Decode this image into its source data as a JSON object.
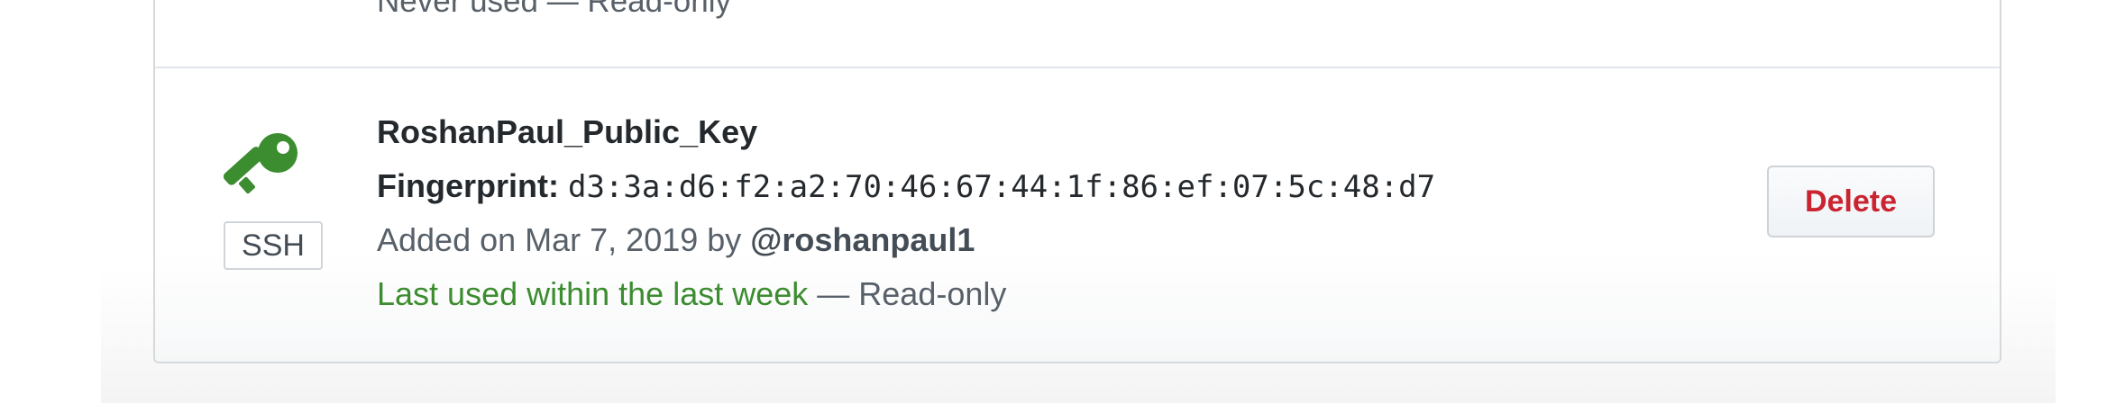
{
  "previous_key": {
    "status": "Never used — Read-only"
  },
  "key": {
    "title": "RoshanPaul_Public_Key",
    "fingerprint_label": "Fingerprint:",
    "fingerprint_value": "d3:3a:d6:f2:a2:70:46:67:44:1f:86:ef:07:5c:48:d7",
    "added_prefix": "Added on Mar 7, 2019 by",
    "added_by": "@roshanpaul1",
    "last_used": "Last used within the last week",
    "access": "— Read-only",
    "type_badge": "SSH",
    "icon": "key-icon",
    "icon_color": "#3b8d2f"
  },
  "actions": {
    "delete_label": "Delete",
    "delete_color": "#cb2431"
  }
}
